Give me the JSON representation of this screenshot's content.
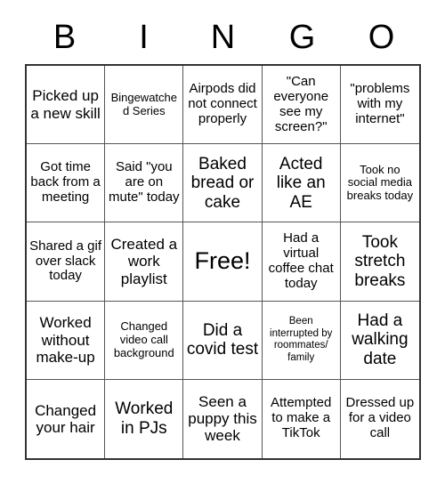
{
  "card": {
    "title_letters": [
      "B",
      "I",
      "N",
      "G",
      "O"
    ],
    "columns": 5,
    "rows": 5,
    "free_space_index": 12,
    "colors": {
      "background": "#ffffff",
      "text": "#000000",
      "outer_border": "#333333",
      "inner_border": "#555555"
    },
    "squares": [
      {
        "text": "Picked up a new skill",
        "size": "lg"
      },
      {
        "text": "Bingewatched Series",
        "size": "sm"
      },
      {
        "text": "Airpods did not connect properly",
        "size": "md"
      },
      {
        "text": "\"Can everyone see my screen?\"",
        "size": "md"
      },
      {
        "text": "\"problems with my internet\"",
        "size": "md"
      },
      {
        "text": "Got time back from a meeting",
        "size": "md"
      },
      {
        "text": "Said \"you are on mute\" today",
        "size": "md"
      },
      {
        "text": "Baked bread or cake",
        "size": "xl"
      },
      {
        "text": "Acted like an AE",
        "size": "xl"
      },
      {
        "text": "Took no social media breaks today",
        "size": "sm"
      },
      {
        "text": "Shared a gif over slack today",
        "size": "md"
      },
      {
        "text": "Created a work playlist",
        "size": "lg"
      },
      {
        "text": "Free!",
        "size": "xxl"
      },
      {
        "text": "Had a virtual coffee chat today",
        "size": "md"
      },
      {
        "text": "Took stretch breaks",
        "size": "xl"
      },
      {
        "text": "Worked without make-up",
        "size": "lg"
      },
      {
        "text": "Changed video call background",
        "size": "sm"
      },
      {
        "text": "Did a covid test",
        "size": "xl"
      },
      {
        "text": "Been interrupted by roommates/ family",
        "size": "xs"
      },
      {
        "text": "Had a walking date",
        "size": "xl"
      },
      {
        "text": "Changed your hair",
        "size": "lg"
      },
      {
        "text": "Worked in PJs",
        "size": "xl"
      },
      {
        "text": "Seen a puppy this week",
        "size": "lg"
      },
      {
        "text": "Attempted to make a TikTok",
        "size": "md"
      },
      {
        "text": "Dressed up for a video call",
        "size": "md"
      }
    ]
  }
}
